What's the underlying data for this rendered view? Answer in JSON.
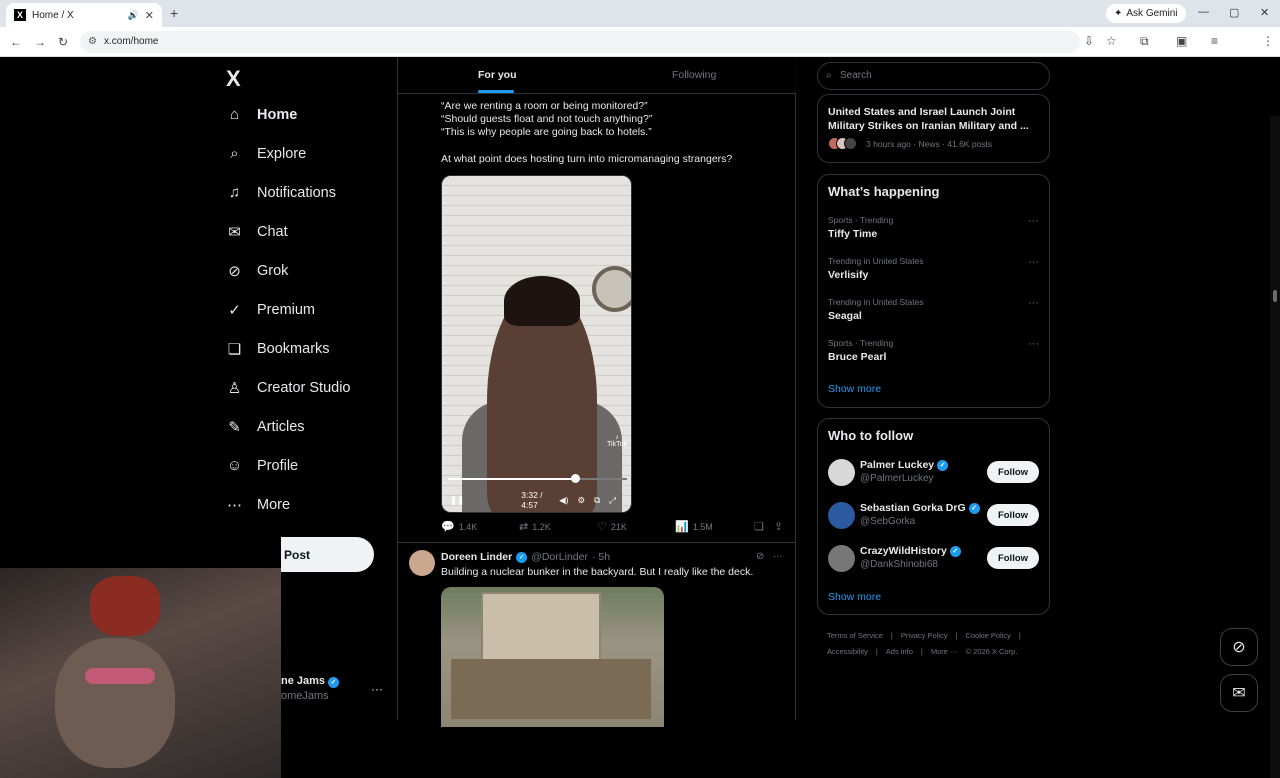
{
  "browser": {
    "tab_title": "Home / X",
    "tab_favicon": "X",
    "new_tab": "+",
    "ask_gemini": "Ask Gemini",
    "url": "x.com/home",
    "window_min": "—",
    "window_max": "▢",
    "window_close": "✕"
  },
  "sidebar": {
    "logo": "X",
    "items": [
      {
        "label": "Home",
        "icon": "⌂"
      },
      {
        "label": "Explore",
        "icon": "⌕"
      },
      {
        "label": "Notifications",
        "icon": "♫"
      },
      {
        "label": "Chat",
        "icon": "✉"
      },
      {
        "label": "Grok",
        "icon": "⊘"
      },
      {
        "label": "Premium",
        "icon": "✓"
      },
      {
        "label": "Bookmarks",
        "icon": "❏"
      },
      {
        "label": "Creator Studio",
        "icon": "♙"
      },
      {
        "label": "Articles",
        "icon": "✎"
      },
      {
        "label": "Profile",
        "icon": "☺"
      },
      {
        "label": "More",
        "icon": "⋯"
      }
    ],
    "post_button": "Post",
    "account_name": "ne Jams",
    "account_handle": "omeJams",
    "account_more": "···"
  },
  "feed": {
    "tabs": [
      "For you",
      "Following"
    ],
    "post1": {
      "lines": [
        "“Are we renting a room or being monitored?”",
        "“Should guests float and not touch anything?”",
        "“This is why people are going back to hotels.”",
        "At what point does hosting turn into micromanaging strangers?"
      ],
      "video_time": "3:32 / 4:57",
      "video_progress": 0.71,
      "tiktok_label": "TikTok",
      "replies": "1.4K",
      "reposts": "1.2K",
      "likes": "21K",
      "views": "1.5M"
    },
    "post2": {
      "name": "Doreen Linder",
      "handle": "@DorLinder",
      "time": "· 5h",
      "text": "Building a nuclear bunker in the backyard. But I really like the deck."
    }
  },
  "right": {
    "search_placeholder": "Search",
    "news": {
      "title": "United States and Israel Launch Joint Military Strikes on Iranian Military and ...",
      "meta": "3 hours ago · News · 41.6K posts"
    },
    "whats_happening": "What’s happening",
    "trends": [
      {
        "category": "Sports · Trending",
        "name": "Tiffy Time"
      },
      {
        "category": "Trending in United States",
        "name": "Verlisify"
      },
      {
        "category": "Trending in United States",
        "name": "Seagal"
      },
      {
        "category": "Sports · Trending",
        "name": "Bruce Pearl"
      }
    ],
    "show_more": "Show more",
    "who_to_follow": "Who to follow",
    "follow_label": "Follow",
    "suggestions": [
      {
        "name": "Palmer Luckey",
        "handle": "@PalmerLuckey"
      },
      {
        "name": "Sebastian Gorka DrG",
        "handle": "@SebGorka"
      },
      {
        "name": "CrazyWildHistory",
        "handle": "@DankShinobi68"
      }
    ],
    "footer": [
      "Terms of Service",
      "|",
      "Privacy Policy",
      "|",
      "Cookie Policy",
      "|",
      "Accessibility",
      "|",
      "Ads info",
      "|",
      "More ···",
      "© 2026 X Corp."
    ]
  }
}
